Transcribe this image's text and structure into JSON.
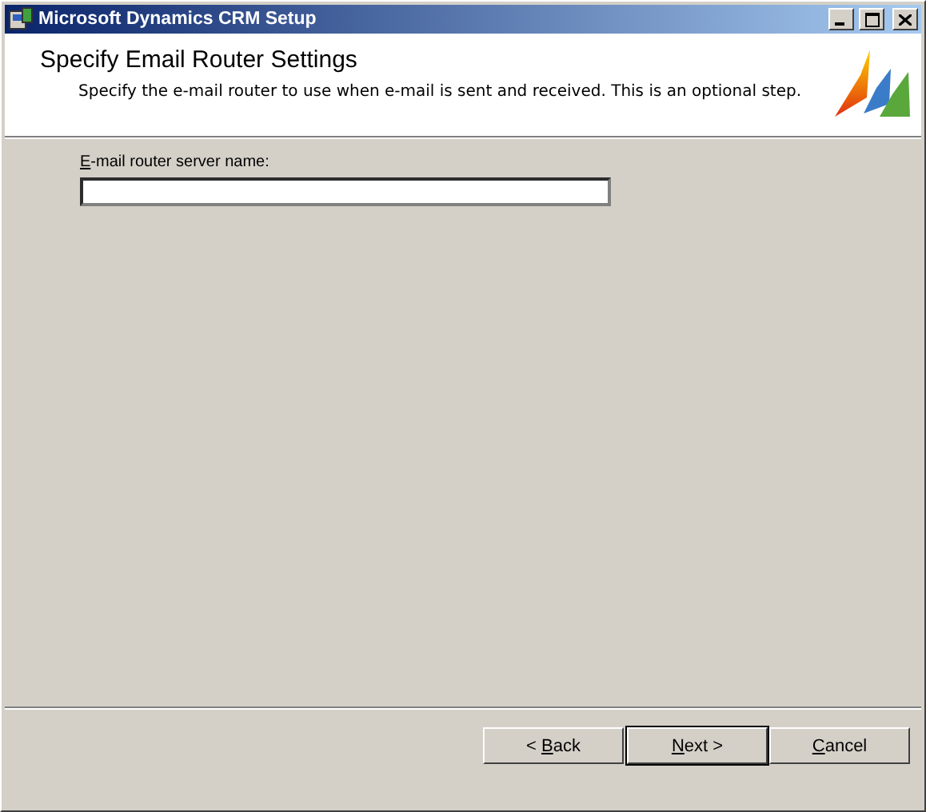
{
  "window": {
    "title": "Microsoft Dynamics CRM Setup",
    "controls": [
      {
        "kind": "minimize"
      },
      {
        "kind": "maximize"
      },
      {
        "kind": "close"
      }
    ]
  },
  "header": {
    "title": "Specify Email Router Settings",
    "subtitle": "Specify the e-mail router to use when e-mail is sent and received. This is an optional step."
  },
  "field": {
    "label": {
      "key": "E",
      "after": "-mail router server name:"
    }
  },
  "buttons": [
    {
      "before": "< ",
      "key": "B",
      "after": "ack",
      "default": false
    },
    {
      "key": "N",
      "after": "ext >",
      "default": true
    },
    {
      "key": "C",
      "after": "ancel",
      "default": false
    }
  ]
}
